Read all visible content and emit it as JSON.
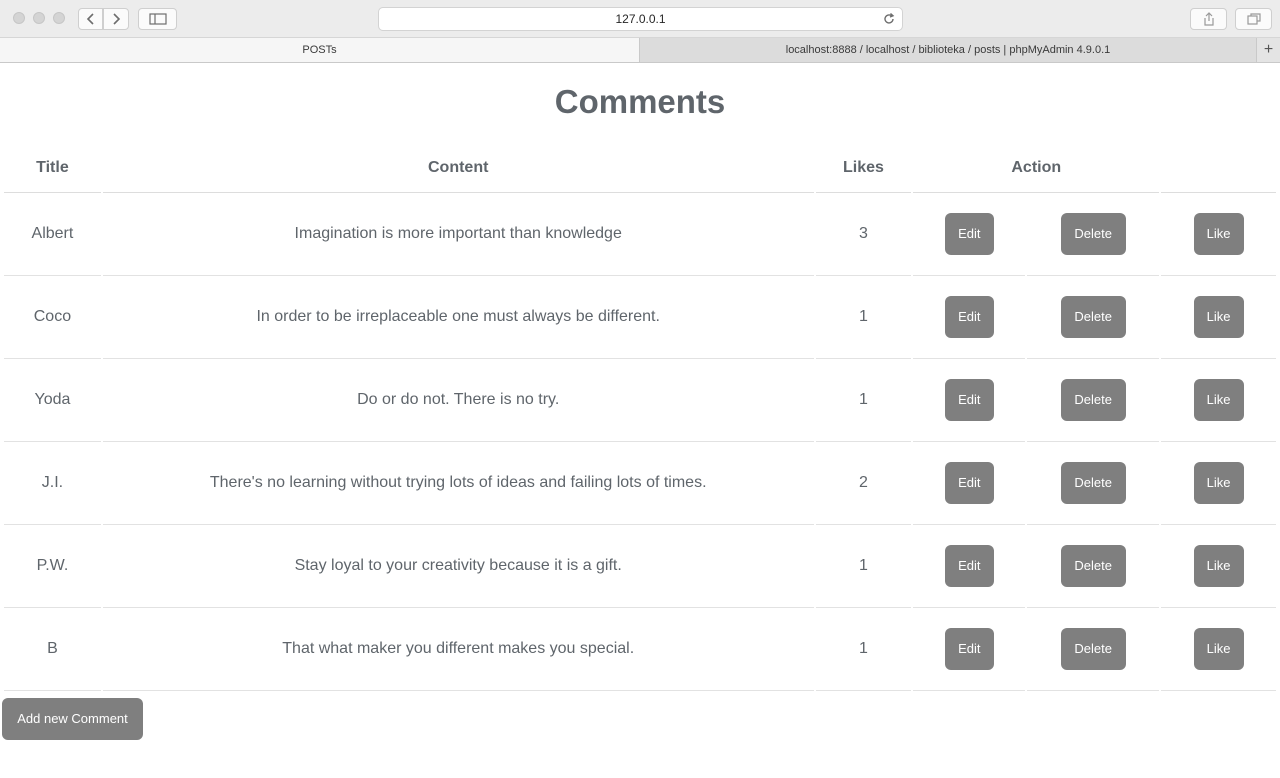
{
  "browser": {
    "address": "127.0.0.1",
    "tabs": [
      {
        "label": "POSTs",
        "active": true
      },
      {
        "label": "localhost:8888 / localhost / biblioteka / posts | phpMyAdmin 4.9.0.1",
        "active": false
      }
    ],
    "new_tab_label": "+"
  },
  "page": {
    "title": "Comments",
    "columns": {
      "title": "Title",
      "content": "Content",
      "likes": "Likes",
      "action": "Action"
    },
    "rows": [
      {
        "title": "Albert",
        "content": "Imagination is more important than knowledge",
        "likes": "3"
      },
      {
        "title": "Coco",
        "content": "In order to be irreplaceable one must always be different.",
        "likes": "1"
      },
      {
        "title": "Yoda",
        "content": "Do or do not. There is no try.",
        "likes": "1"
      },
      {
        "title": "J.I.",
        "content": "There's no learning without trying lots of ideas and failing lots of times.",
        "likes": "2"
      },
      {
        "title": "P.W.",
        "content": "Stay loyal to your creativity because it is a gift.",
        "likes": "1"
      },
      {
        "title": "B",
        "content": "That what maker you different makes you special.",
        "likes": "1"
      }
    ],
    "actions": {
      "edit_label": "Edit",
      "delete_label": "Delete",
      "like_label": "Like"
    },
    "add_button_label": "Add new Comment"
  },
  "colors": {
    "button_bg": "#7f7f7f",
    "text": "#5f656b",
    "chrome_bg": "#ececec"
  }
}
